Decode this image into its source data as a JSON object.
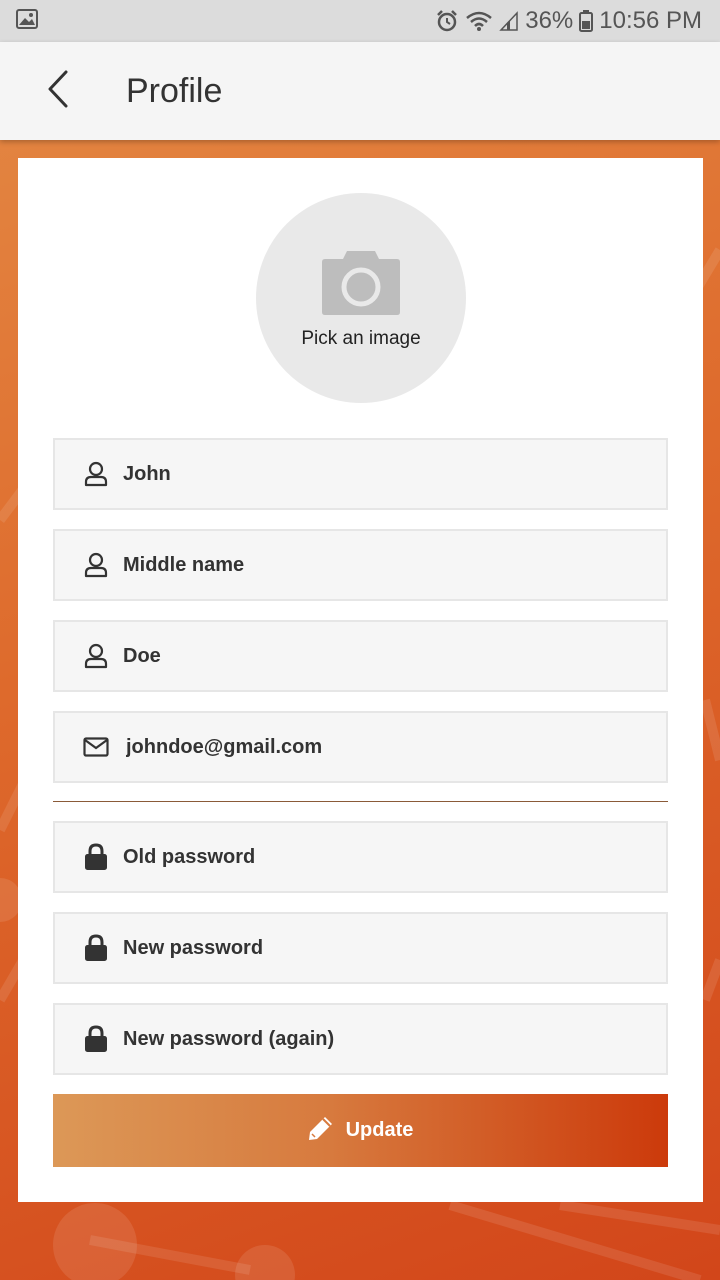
{
  "status_bar": {
    "battery_percent": "36%",
    "time": "10:56 PM",
    "icons": [
      "gallery-notification-icon",
      "alarm-icon",
      "wifi-icon",
      "signal-icon",
      "battery-icon"
    ]
  },
  "app_bar": {
    "title": "Profile",
    "back_icon": "chevron-left-icon"
  },
  "avatar": {
    "label": "Pick an image",
    "icon": "camera-icon"
  },
  "form": {
    "first_name": {
      "value": "John",
      "icon": "person-icon"
    },
    "middle_name": {
      "value": "",
      "placeholder": "Middle name",
      "icon": "person-icon"
    },
    "last_name": {
      "value": "Doe",
      "icon": "person-icon"
    },
    "email": {
      "value": "johndoe@gmail.com",
      "icon": "envelope-icon"
    },
    "old_password": {
      "value": "",
      "placeholder": "Old password",
      "icon": "lock-icon"
    },
    "new_password": {
      "value": "",
      "placeholder": "New password",
      "icon": "lock-icon"
    },
    "new_password_again": {
      "value": "",
      "placeholder": "New password (again)",
      "icon": "lock-icon"
    }
  },
  "update_button": {
    "label": "Update",
    "icon": "pencil-icon"
  },
  "colors": {
    "accent_start": "#dc9857",
    "accent_end": "#cc3a0b",
    "background": "#de6a2c"
  }
}
